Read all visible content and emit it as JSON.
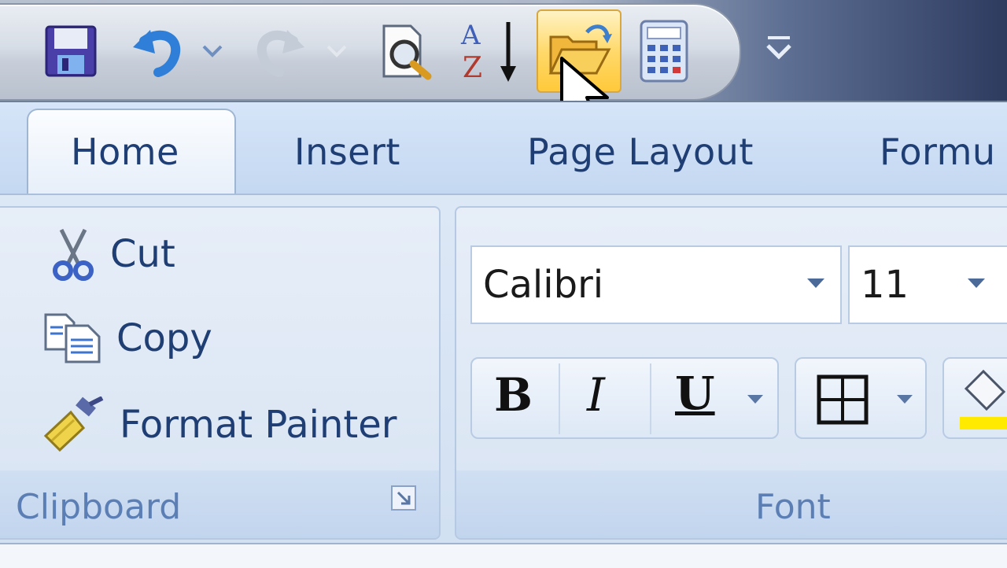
{
  "quick_access": {
    "items": [
      "save-icon",
      "undo-icon",
      "undo-dropdown-icon",
      "redo-icon",
      "redo-dropdown-icon",
      "print-preview-icon",
      "sort-az-icon",
      "open-icon",
      "calculator-icon",
      "customize-qat-icon"
    ]
  },
  "tabs": [
    {
      "label": "Home"
    },
    {
      "label": "Insert"
    },
    {
      "label": "Page Layout"
    },
    {
      "label": "Formu"
    }
  ],
  "clipboard": {
    "cut_label": "Cut",
    "copy_label": "Copy",
    "format_painter_label": "Format Painter",
    "group_label": "Clipboard"
  },
  "font": {
    "font_name": "Calibri",
    "font_size": "11",
    "bold_label": "B",
    "italic_label": "I",
    "underline_label": "U",
    "group_label": "Font"
  },
  "colors": {
    "ribbon_text": "#1f3e74",
    "group_label": "#5b7fb5",
    "highlight_yellow": "#ffea00"
  }
}
